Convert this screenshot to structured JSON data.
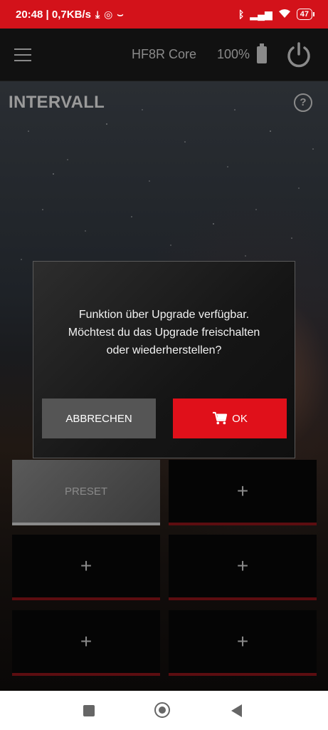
{
  "status_bar": {
    "time_speed": "20:48 | 0,7KB/s",
    "battery_percent": "47",
    "icons": [
      "download-icon",
      "instagram-icon",
      "amazon-icon",
      "bluetooth-icon",
      "signal-icon",
      "wifi-icon",
      "battery-icon"
    ]
  },
  "appbar": {
    "title": "HF8R Core",
    "battery": "100%",
    "icons": [
      "menu-icon",
      "battery-icon",
      "power-icon"
    ]
  },
  "page": {
    "title": "INTERVALL",
    "help_symbol": "?"
  },
  "grid": {
    "tiles": [
      {
        "label": "PRESET"
      },
      {
        "label": "+"
      },
      {
        "label": "+"
      },
      {
        "label": "+"
      },
      {
        "label": "+"
      },
      {
        "label": "+"
      }
    ]
  },
  "dialog": {
    "message_lines": [
      "Funktion über Upgrade verfügbar.",
      "Möchtest du das Upgrade freischalten",
      "oder wiederherstellen?"
    ],
    "cancel_label": "ABBRECHEN",
    "ok_label": "OK"
  },
  "colors": {
    "accent_red": "#e0101a",
    "status_bar_red": "#d3121a",
    "muted_text": "#8a8a8a"
  },
  "navbar": {
    "icons": [
      "recents-icon",
      "home-icon",
      "back-icon"
    ]
  }
}
